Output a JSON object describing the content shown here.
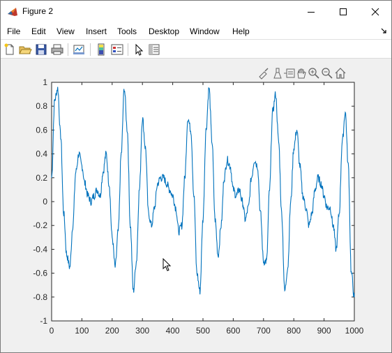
{
  "window": {
    "title": "Figure 2"
  },
  "menu": {
    "items": [
      "File",
      "Edit",
      "View",
      "Insert",
      "Tools",
      "Desktop",
      "Window",
      "Help"
    ]
  },
  "toolbar": {
    "buttons": [
      "new-figure-icon",
      "open-file-icon",
      "save-icon",
      "print-icon",
      "link-plot-icon",
      "colorbar-icon",
      "legend-icon",
      "edit-plot-icon",
      "property-inspector-icon"
    ]
  },
  "axes_toolbar": {
    "buttons": [
      "brush-icon",
      "data-tips-icon",
      "rotate-icon",
      "pan-icon",
      "zoom-in-icon",
      "zoom-out-icon",
      "home-icon"
    ]
  },
  "colors": {
    "line": "#0072bd",
    "figure_bg": "#f0f0f0",
    "axes_bg": "#ffffff",
    "axis": "#262626"
  },
  "chart_data": {
    "type": "line",
    "title": "",
    "xlabel": "",
    "ylabel": "",
    "xlim": [
      0,
      1000
    ],
    "ylim": [
      -1,
      1
    ],
    "xticks": [
      "0",
      "100",
      "200",
      "300",
      "400",
      "500",
      "600",
      "700",
      "800",
      "900",
      "1000"
    ],
    "yticks": [
      "1",
      "0.8",
      "0.6",
      "0.4",
      "0.2",
      "0",
      "-0.2",
      "-0.4",
      "-0.6",
      "-0.8",
      "-1"
    ],
    "grid": false,
    "series": [
      {
        "x": [
          0,
          10,
          20,
          30,
          40,
          50,
          60,
          70,
          80,
          90,
          100,
          110,
          120,
          130,
          140,
          150,
          160,
          170,
          180,
          190,
          200,
          210,
          220,
          230,
          240,
          250,
          260,
          270,
          280,
          290,
          300,
          310,
          320,
          330,
          340,
          350,
          360,
          370,
          380,
          390,
          400,
          410,
          420,
          430,
          440,
          450,
          460,
          470,
          480,
          490,
          500,
          510,
          520,
          530,
          540,
          550,
          560,
          570,
          580,
          590,
          600,
          610,
          620,
          630,
          640,
          650,
          660,
          670,
          680,
          690,
          700,
          710,
          720,
          730,
          740,
          750,
          760,
          770,
          780,
          790,
          800,
          810,
          820,
          830,
          840,
          850,
          860,
          870,
          880,
          890,
          900,
          910,
          920,
          930,
          940,
          950,
          960,
          970,
          980,
          990,
          1000
        ],
        "y": [
          0.2,
          0.85,
          0.95,
          0.55,
          -0.1,
          -0.45,
          -0.55,
          -0.2,
          0.25,
          0.4,
          0.3,
          0.15,
          0.05,
          0.0,
          0.05,
          0.1,
          0.05,
          0.25,
          0.4,
          0.15,
          -0.3,
          -0.55,
          -0.25,
          0.4,
          0.95,
          0.6,
          -0.2,
          -0.75,
          -0.5,
          0.1,
          0.7,
          0.45,
          -0.1,
          -0.2,
          -0.05,
          0.15,
          0.2,
          0.2,
          0.15,
          0.1,
          0.05,
          -0.05,
          -0.25,
          -0.2,
          0.2,
          0.7,
          0.6,
          0.05,
          -0.6,
          -0.75,
          -0.15,
          0.6,
          0.95,
          0.5,
          -0.15,
          -0.45,
          -0.2,
          0.2,
          0.35,
          0.3,
          0.1,
          0.05,
          0.1,
          0.0,
          -0.15,
          -0.05,
          0.2,
          0.35,
          0.3,
          -0.1,
          -0.5,
          -0.5,
          0.1,
          0.75,
          0.9,
          0.5,
          -0.1,
          -0.75,
          -0.55,
          0.0,
          0.45,
          0.6,
          0.3,
          0.05,
          -0.05,
          -0.2,
          -0.1,
          0.1,
          0.2,
          0.15,
          0.05,
          -0.05,
          -0.05,
          -0.2,
          -0.4,
          -0.1,
          0.5,
          0.75,
          0.3,
          -0.6,
          -0.8
        ]
      }
    ]
  }
}
